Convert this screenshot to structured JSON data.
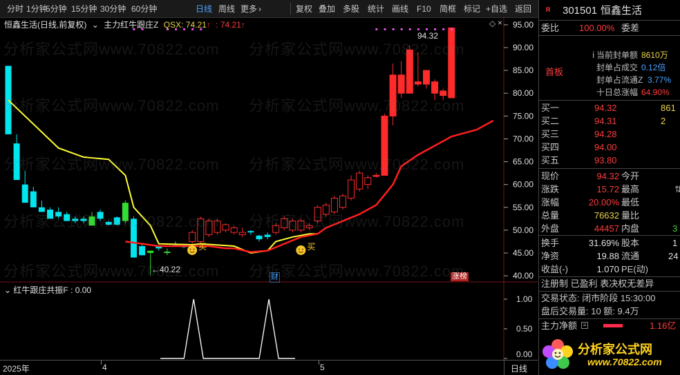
{
  "toolbar": {
    "periods": [
      "分时",
      "1分钟",
      "5分钟",
      "15分钟",
      "30分钟",
      "60分钟",
      "日线",
      "周线",
      "更多"
    ],
    "more_arrow": "›",
    "tools": [
      "复权",
      "叠加",
      "多股",
      "统计",
      "画线",
      "F10",
      "简框",
      "标记",
      "+自选",
      "返回"
    ]
  },
  "chart": {
    "stock_label": "恒鑫生活",
    "period_label": "(日线,前复权)",
    "formula": "主力红牛跟庄Z",
    "qsx_label": "QSX: 74.21",
    "qsx_label2": ": 74.21",
    "up_arrow": "↑",
    "high_mark": "94.32",
    "low_mark": "←40.22",
    "buy_label": "买",
    "finance_tag": "财",
    "zhangbang_tag": "涨榜",
    "y_ticks": [
      "95.00",
      "90.00",
      "85.00",
      "80.00",
      "75.00",
      "70.00",
      "65.00",
      "60.00",
      "55.00",
      "50.00",
      "45.00",
      "40.00"
    ],
    "ind_label": "红牛跟庄共振F : 0.00",
    "ind_ticks": [
      "1.00",
      "0.50",
      "0.00"
    ],
    "x_ticks": [
      "2025年",
      "4",
      "5"
    ],
    "period_corner": "日线",
    "watermark": "分析家公式网www.70822.com"
  },
  "chart_data": {
    "type": "candlestick",
    "ylim": [
      38.5,
      96.5
    ],
    "candles": [
      [
        86,
        86,
        71,
        71,
        "c"
      ],
      [
        69,
        71,
        61,
        61,
        "c"
      ],
      [
        60,
        63,
        56,
        56,
        "c"
      ],
      [
        58.5,
        59.5,
        55,
        55,
        "c"
      ],
      [
        55,
        56.5,
        54,
        54,
        "c"
      ],
      [
        54.5,
        55,
        52.5,
        52.5,
        "c"
      ],
      [
        54,
        55,
        52.5,
        53,
        "c"
      ],
      [
        53.5,
        54,
        52,
        52,
        "c"
      ],
      [
        52.5,
        53,
        51.5,
        52,
        "c"
      ],
      [
        52.5,
        53,
        51.5,
        52,
        "c"
      ],
      [
        53,
        54,
        51,
        51,
        "g"
      ],
      [
        54,
        54.5,
        52,
        52.5,
        "c"
      ],
      [
        51.8,
        52,
        51,
        51.2,
        "c"
      ],
      [
        52.8,
        53,
        51,
        51.2,
        "c"
      ],
      [
        56,
        56.5,
        51.5,
        52,
        "g"
      ],
      [
        52.5,
        53,
        44,
        44,
        "c"
      ],
      [
        46.5,
        47,
        44.5,
        44.5,
        "c"
      ],
      [
        45.5,
        45.5,
        40.2,
        45,
        "g"
      ],
      [
        46.5,
        46.5,
        45.5,
        46,
        "c"
      ],
      [
        45,
        46,
        44.5,
        45.3,
        "g"
      ],
      [
        47,
        47.5,
        46.5,
        46.8,
        "c"
      ],
      [
        46.5,
        47,
        46,
        46.5,
        "c"
      ],
      [
        47.5,
        50,
        47,
        49.5,
        "r"
      ],
      [
        47.5,
        53,
        47,
        52.5,
        "r"
      ],
      [
        49,
        52.5,
        48.5,
        52,
        "r"
      ],
      [
        49.5,
        52.5,
        49,
        52,
        "r"
      ],
      [
        50,
        51.5,
        49.5,
        51.2,
        "r"
      ],
      [
        49.5,
        51,
        49,
        50.5,
        "r"
      ],
      [
        49,
        50.5,
        48.5,
        49.5,
        "r"
      ],
      [
        49.5,
        50,
        49,
        49.8,
        "c"
      ],
      [
        48,
        49,
        47.5,
        48.8,
        "c"
      ],
      [
        48.5,
        49.5,
        48,
        49,
        "c"
      ],
      [
        49.5,
        51.5,
        49,
        51,
        "r"
      ],
      [
        50.5,
        53,
        50,
        52.5,
        "r"
      ],
      [
        50,
        52.5,
        49.5,
        52,
        "r"
      ],
      [
        50,
        52.5,
        49.5,
        52,
        "r"
      ],
      [
        50.5,
        51.5,
        50,
        51,
        "r"
      ],
      [
        52,
        55.5,
        51.5,
        55,
        "r"
      ],
      [
        53.5,
        56,
        53,
        55.5,
        "r"
      ],
      [
        54,
        57.5,
        53.5,
        57,
        "r"
      ],
      [
        55,
        58,
        54.5,
        57.5,
        "r"
      ],
      [
        57,
        62,
        56.5,
        61,
        "r"
      ],
      [
        59,
        63,
        58.5,
        62.5,
        "r"
      ],
      [
        60,
        62,
        59,
        61.5,
        "r"
      ],
      [
        62,
        62.5,
        61.5,
        62,
        "r"
      ],
      [
        62,
        75.5,
        62,
        75,
        "r"
      ],
      [
        75,
        86.5,
        73,
        84,
        "r"
      ],
      [
        80,
        87,
        79,
        84,
        "r"
      ],
      [
        80,
        90.5,
        80,
        89.5,
        "r"
      ],
      [
        82,
        89,
        81.5,
        82.5,
        "r"
      ],
      [
        82,
        84.5,
        81,
        85,
        "r"
      ],
      [
        80,
        83,
        78.5,
        82.5,
        "r"
      ],
      [
        79.5,
        81,
        78.5,
        80.5,
        "r"
      ],
      [
        79,
        94.32,
        79,
        94.32,
        "r"
      ]
    ],
    "qsx_line": [
      [
        0,
        78.5
      ],
      [
        6,
        68
      ],
      [
        9,
        66
      ],
      [
        12,
        65.5
      ],
      [
        14,
        62
      ],
      [
        15,
        55
      ],
      [
        17,
        51
      ],
      [
        18,
        47
      ],
      [
        22,
        46.8
      ],
      [
        23,
        47
      ],
      [
        27,
        46.5
      ],
      [
        29,
        45
      ],
      [
        31,
        45.5
      ],
      [
        32,
        47.5
      ],
      [
        34,
        48.5
      ],
      [
        36,
        49.2
      ],
      [
        37,
        49.2
      ]
    ],
    "red_line": [
      [
        14,
        47.5
      ],
      [
        18,
        46.5
      ],
      [
        22,
        46.5
      ],
      [
        24,
        46.5
      ],
      [
        26,
        46
      ],
      [
        27,
        46
      ],
      [
        29,
        45.2
      ],
      [
        31,
        45.5
      ],
      [
        33,
        47
      ],
      [
        35,
        48.5
      ],
      [
        37,
        49.2
      ],
      [
        38,
        50.5
      ],
      [
        40,
        52
      ],
      [
        42,
        53.5
      ],
      [
        44,
        55.5
      ],
      [
        46,
        60
      ],
      [
        47,
        64
      ],
      [
        49,
        66.5
      ],
      [
        51,
        68.5
      ],
      [
        53,
        70.5
      ],
      [
        56,
        72
      ],
      [
        58,
        74
      ]
    ],
    "buy_points": [
      21,
      34
    ],
    "buy_price": 45.3,
    "ind_values": [
      0,
      0,
      0,
      0,
      0,
      0,
      0,
      0,
      0,
      0,
      0,
      0,
      0,
      0,
      0,
      0,
      0,
      0,
      0,
      0,
      0,
      0,
      1,
      0,
      0,
      0,
      0,
      0,
      0,
      0,
      0,
      1,
      0,
      0,
      0,
      0,
      0,
      0,
      0,
      0,
      0,
      0,
      0,
      0,
      0,
      0,
      0,
      0,
      0,
      0,
      0,
      0,
      0,
      0
    ],
    "colors": {
      "up": "#ff2b2b",
      "down": "#00e5ee",
      "green": "#33dd33",
      "qsx": "#ffff33",
      "red_line": "#ff1e1e"
    }
  },
  "panel": {
    "code": "301501",
    "name": "恒鑫生活",
    "r_badge": "R",
    "wb_label": "委比",
    "wb_value": "100.00%",
    "wc_label": "委差",
    "board": "首板",
    "seal_amt_label": "当前封单额",
    "seal_amt": "8610万",
    "seal_vol_label": "封单占成交",
    "seal_vol": "0.12倍",
    "seal_float_label": "封单占流通Z",
    "seal_float": "3.77%",
    "ten_day_label": "十日总涨幅",
    "ten_day": "64.90%",
    "bids": [
      {
        "label": "买一",
        "price": "94.32",
        "vol": "861"
      },
      {
        "label": "买二",
        "price": "94.31",
        "vol": "2"
      },
      {
        "label": "买三",
        "price": "94.28",
        "vol": ""
      },
      {
        "label": "买四",
        "price": "94.00",
        "vol": ""
      },
      {
        "label": "买五",
        "price": "93.80",
        "vol": ""
      }
    ],
    "price_label": "现价",
    "price": "94.32",
    "open_label": "今开",
    "chg_label": "涨跌",
    "chg": "15.72",
    "high_label": "最高",
    "pct_label": "涨幅",
    "pct": "20.00%",
    "low_label": "最低",
    "vol_label": "总量",
    "vol": "76632",
    "vr_label": "量比",
    "out_label": "外盘",
    "out": "44457",
    "in_label": "内盘",
    "in_val": "3",
    "turn_label": "换手",
    "turn": "31.69%",
    "cap_label": "股本",
    "cap_val": "1",
    "nav_label": "净资",
    "nav": "19.88",
    "float_label": "流通",
    "float_val": "24",
    "eps_label": "收益(-)",
    "eps": "1.070",
    "pe_label": "PE(动)",
    "notes": "注册制 已盈利 表决权无差异",
    "trade_state": "交易状态: 闭市阶段 15:30:00",
    "after_hours": "盘后交易量: 10  额: 9.4万",
    "mf_label": "主力净额",
    "mf_value": "1.16亿",
    "logo_text": "分析家公式网",
    "logo_url": "www.70822.com"
  }
}
